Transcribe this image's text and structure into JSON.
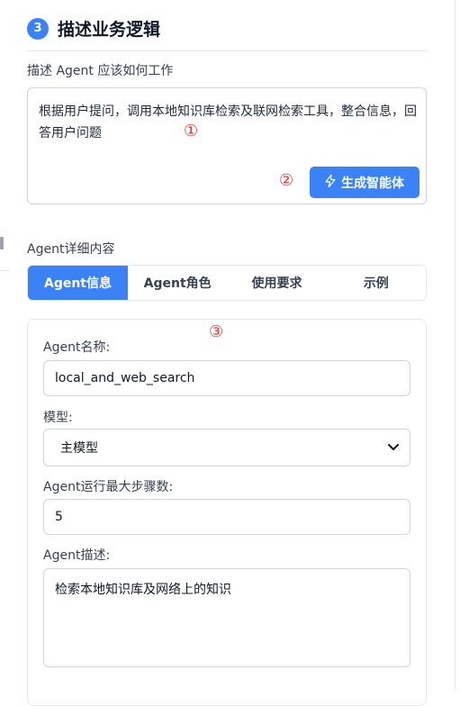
{
  "step": {
    "number": "3",
    "title": "描述业务逻辑"
  },
  "description": {
    "label": "描述 Agent 应该如何工作",
    "text": "根据用户提问，调用本地知识库检索及联网检索工具，整合信息，回答用户问题",
    "marker": "①"
  },
  "generate": {
    "label": "生成智能体",
    "marker": "②",
    "icon": "lightning-icon"
  },
  "details": {
    "label": "Agent详细内容",
    "tabs": [
      {
        "label": "Agent信息",
        "active": true
      },
      {
        "label": "Agent角色",
        "active": false
      },
      {
        "label": "使用要求",
        "active": false
      },
      {
        "label": "示例",
        "active": false
      }
    ],
    "marker": "③",
    "fields": {
      "name": {
        "label": "Agent名称:",
        "value": "local_and_web_search"
      },
      "model": {
        "label": "模型:",
        "value": "主模型"
      },
      "max_steps": {
        "label": "Agent运行最大步骤数:",
        "value": "5"
      },
      "description": {
        "label": "Agent描述:",
        "value": "检索本地知识库及网络上的知识"
      }
    }
  },
  "colors": {
    "accent": "#3b82f6",
    "marker": "#e53935",
    "border": "#d1d5db"
  }
}
